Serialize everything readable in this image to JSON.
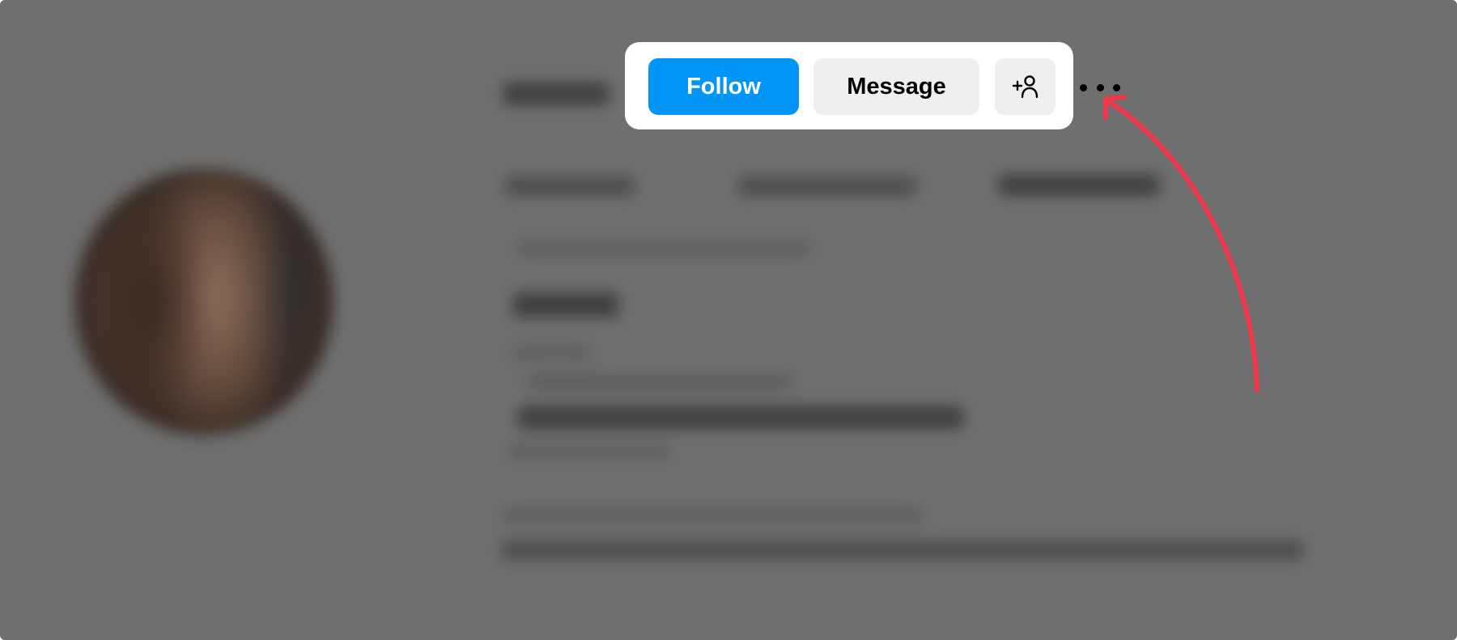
{
  "profile_actions": {
    "follow_label": "Follow",
    "message_label": "Message",
    "add_user_icon": "person-plus-icon",
    "more_icon": "more-options-icon"
  },
  "colors": {
    "follow_button": "#0095f6",
    "secondary_button": "#efefef",
    "annotation_arrow": "#f0384a",
    "overlay": "#6f6f6f"
  }
}
